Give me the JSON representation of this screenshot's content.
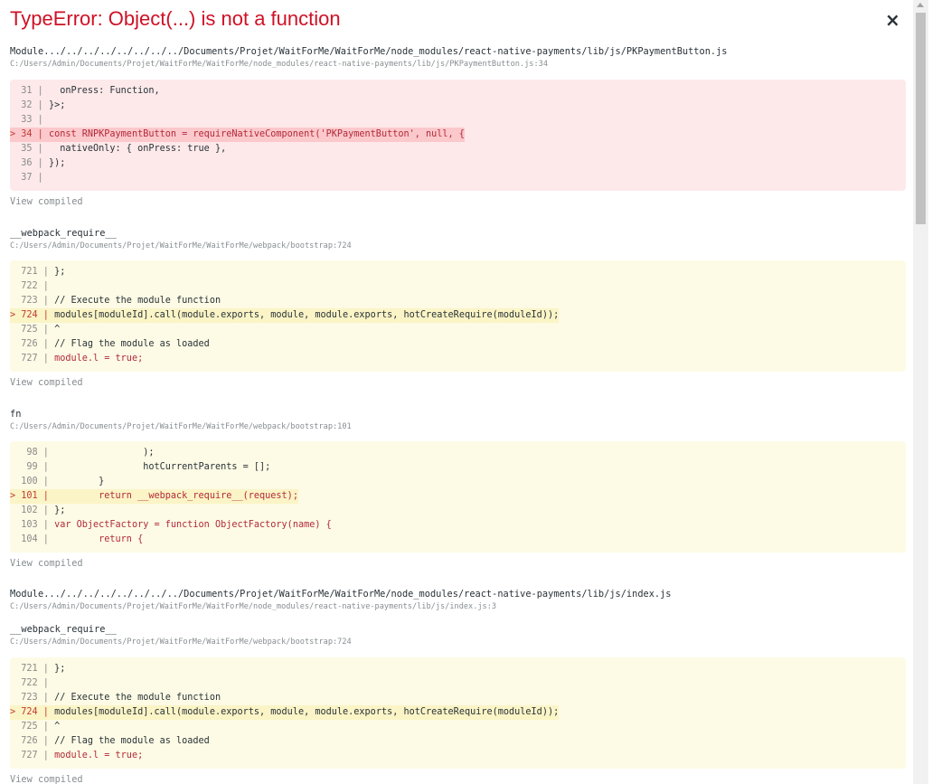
{
  "error": {
    "title": "TypeError: Object(...) is not a function",
    "close_glyph": "×"
  },
  "frames": [
    {
      "fn": "Module.../../../../../../../../Documents/Projet/WaitForMe/WaitForMe/node_modules/react-native-payments/lib/js/PKPaymentButton.js",
      "loc": "C:/Users/Admin/Documents/Projet/WaitForMe/WaitForMe/node_modules/react-native-payments/lib/js/PKPaymentButton.js:34",
      "view": "View compiled",
      "lines": [
        {
          "gutter": "  31 | ",
          "code": "  onPress: Function,"
        },
        {
          "gutter": "  32 | ",
          "code": "}>;"
        },
        {
          "gutter": "  33 | ",
          "code": ""
        },
        {
          "gutter": "> 34 | ",
          "code": "const RNPKPaymentButton = requireNativeComponent('PKPaymentButton', null, {"
        },
        {
          "gutter": "  35 | ",
          "code": "  nativeOnly: { onPress: true },"
        },
        {
          "gutter": "  36 | ",
          "code": "});"
        },
        {
          "gutter": "  37 | ",
          "code": ""
        }
      ]
    },
    {
      "fn": "__webpack_require__",
      "loc": "C:/Users/Admin/Documents/Projet/WaitForMe/WaitForMe/webpack/bootstrap:724",
      "view": "View compiled",
      "lines": [
        {
          "gutter": "  721 | ",
          "code": "};"
        },
        {
          "gutter": "  722 | ",
          "code": ""
        },
        {
          "gutter": "  723 | ",
          "code": "// Execute the module function"
        },
        {
          "gutter": "> 724 | ",
          "code": "modules[moduleId].call(module.exports, module, module.exports, hotCreateRequire(moduleId));"
        },
        {
          "gutter": "  725 | ",
          "code": "^"
        },
        {
          "gutter": "  726 | ",
          "code": "// Flag the module as loaded"
        },
        {
          "gutter": "  727 | ",
          "code": "module.l = true;"
        }
      ]
    },
    {
      "fn": "fn",
      "loc": "C:/Users/Admin/Documents/Projet/WaitForMe/WaitForMe/webpack/bootstrap:101",
      "view": "View compiled",
      "lines": [
        {
          "gutter": "   98 | ",
          "code": "                );"
        },
        {
          "gutter": "   99 | ",
          "code": "                hotCurrentParents = [];"
        },
        {
          "gutter": "  100 | ",
          "code": "        }"
        },
        {
          "gutter": "> 101 | ",
          "code": "        return __webpack_require__(request);"
        },
        {
          "gutter": "  102 | ",
          "code": "};"
        },
        {
          "gutter": "  103 | ",
          "code": "var ObjectFactory = function ObjectFactory(name) {"
        },
        {
          "gutter": "  104 | ",
          "code": "        return {"
        }
      ]
    },
    {
      "fn": "Module.../../../../../../../../Documents/Projet/WaitForMe/WaitForMe/node_modules/react-native-payments/lib/js/index.js",
      "loc": "C:/Users/Admin/Documents/Projet/WaitForMe/WaitForMe/node_modules/react-native-payments/lib/js/index.js:3"
    },
    {
      "fn": "__webpack_require__",
      "loc": "C:/Users/Admin/Documents/Projet/WaitForMe/WaitForMe/webpack/bootstrap:724",
      "view": "View compiled",
      "lines": [
        {
          "gutter": "  721 | ",
          "code": "};"
        },
        {
          "gutter": "  722 | ",
          "code": ""
        },
        {
          "gutter": "  723 | ",
          "code": "// Execute the module function"
        },
        {
          "gutter": "> 724 | ",
          "code": "modules[moduleId].call(module.exports, module, module.exports, hotCreateRequire(moduleId));"
        },
        {
          "gutter": "  725 | ",
          "code": "^"
        },
        {
          "gutter": "  726 | ",
          "code": "// Flag the module as loaded"
        },
        {
          "gutter": "  727 | ",
          "code": "module.l = true;"
        }
      ]
    }
  ],
  "colors": {
    "error_red": "#ce1126",
    "red_bg": "#fde9ea",
    "yellow_bg": "#fdfbe5"
  }
}
